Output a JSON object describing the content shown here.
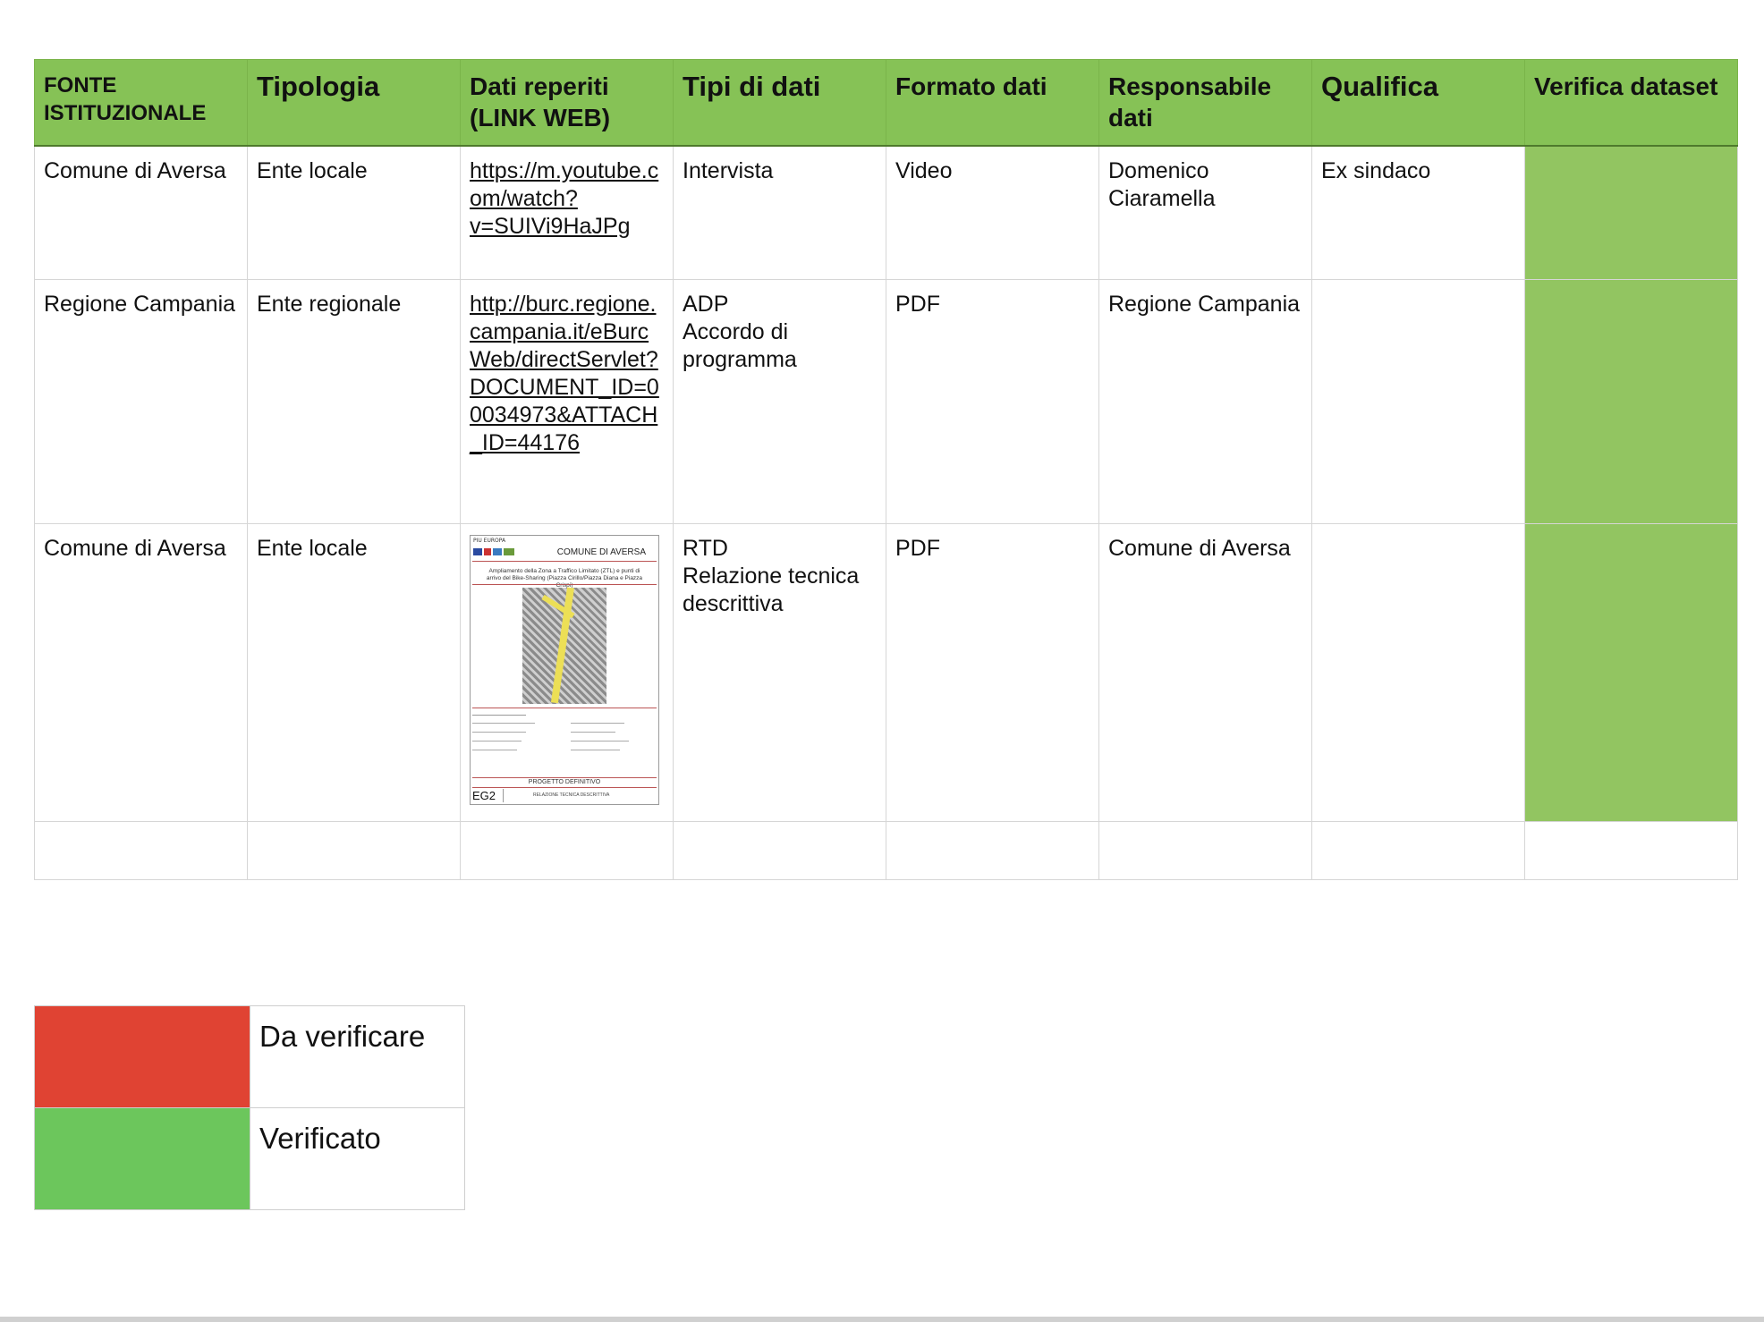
{
  "headers": {
    "fonte": "FONTE ISTITUZIONALE",
    "tipologia": "Tipologia",
    "dati": "Dati reperiti (LINK WEB)",
    "tipi": "Tipi di dati",
    "formato": "Formato dati",
    "responsabile": "Responsabile dati",
    "qualifica": "Qualifica",
    "verifica": "Verifica dataset"
  },
  "rows": [
    {
      "fonte": "Comune di Aversa",
      "tipologia": "Ente locale",
      "link": "https://m.youtube.com/watch?v=SUIVi9HaJPg",
      "tipi_line1": "Intervista",
      "tipi_line2": "",
      "formato": "Video",
      "responsabile": "Domenico Ciaramella",
      "qualifica": "Ex sindaco",
      "verifica_color": "#92c561"
    },
    {
      "fonte": "Regione Campania",
      "tipologia": "Ente regionale",
      "link": "http://burc.regione.campania.it/eBurcWeb/directServlet?DOCUMENT_ID=00034973&ATTACH_ID=44176",
      "tipi_line1": "ADP",
      "tipi_line2": "Accordo di programma",
      "formato": "PDF",
      "responsabile": "Regione Campania",
      "qualifica": "",
      "verifica_color": "#92c561"
    },
    {
      "fonte": "Comune di Aversa",
      "tipologia": "Ente locale",
      "tipi_line1": "RTD",
      "tipi_line2": "Relazione tecnica descrittiva",
      "formato": "PDF",
      "responsabile": "Comune di Aversa",
      "qualifica": "",
      "verifica_color": "#92c561"
    }
  ],
  "thumbnail": {
    "top_text": "PIU EUROPA",
    "city": "COMUNE DI AVERSA",
    "description": "Ampliamento della Zona a Traffico Limitato (ZTL) e punti di arrivo del Bike-Sharing (Piazza Cirillo/Piazza Diana e Piazza Crispi)",
    "project_label": "PROGETTO DEFINITIVO",
    "code": "EG2",
    "report_label": "RELAZIONE TECNICA DESCRITTIVA"
  },
  "legend": [
    {
      "label": "Da verificare",
      "color": "#e04333"
    },
    {
      "label": "Verificato",
      "color": "#6cc65c"
    }
  ],
  "colors": {
    "header_bg": "#86c256",
    "verify_cell": "#92c561"
  }
}
